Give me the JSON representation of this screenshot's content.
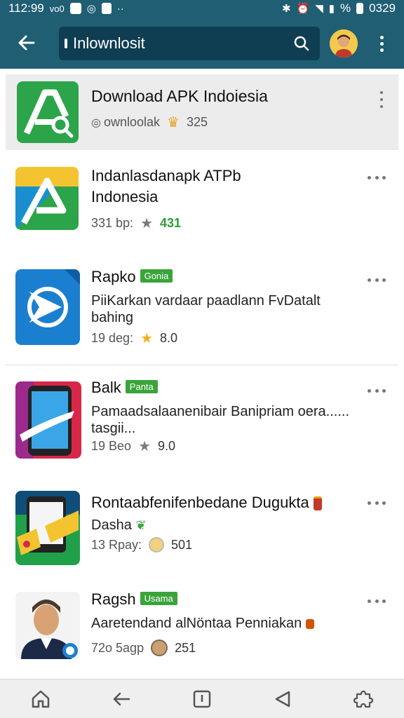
{
  "status_bar": {
    "time": "112:99",
    "carrier": "vo0",
    "battery_text": "0329",
    "signal_text": "%"
  },
  "app_bar": {
    "search_query": "Inlownlosit"
  },
  "featured": {
    "title": "Download APK Indoiesia",
    "sub_text": "ownloolak",
    "count": "325",
    "colors": {
      "icon_bg": "#2ca44a"
    }
  },
  "apps": [
    {
      "title": "Indanlasdanapk ATPb",
      "title_line2": "Indonesia",
      "meta_size": "331 bp:",
      "rating": "431",
      "rating_style": "green"
    },
    {
      "title": "Rapko",
      "badge": "Gonia",
      "desc_line1": "PiiKarkan vardaar paadlann FvDatalt",
      "desc_line2": "bahing",
      "meta_size": "19 deg:",
      "rating": "8.0",
      "rating_style": "dark"
    },
    {
      "title": "Balk",
      "badge": "Panta",
      "desc_line1": "Pamaadsalaanenibair Banipriam oera......",
      "desc_line2": "tasgii...",
      "meta_size": "19 Beo",
      "rating": "9.0",
      "rating_style": "dark"
    },
    {
      "title": "Rontaabfenifenbedane Dugukta",
      "desc_line1": "Dasha",
      "meta_size": "13 Rpay:",
      "rating": "501",
      "rating_style": "dark"
    },
    {
      "title": "Ragsh",
      "badge": "Usama",
      "desc_line1": "Aaretendand alNöntaa Penniakan",
      "meta_size": "72o 5agp",
      "rating": "251",
      "rating_style": "dark"
    }
  ],
  "nav_bar": {
    "icons": [
      "home-icon",
      "back-arrow-icon",
      "square-icon",
      "triangle-back-icon",
      "puzzle-icon"
    ]
  },
  "colors": {
    "app_bar": "#1f5e73",
    "search_bg": "#0f3e52",
    "badge_green": "#3aa43a"
  }
}
